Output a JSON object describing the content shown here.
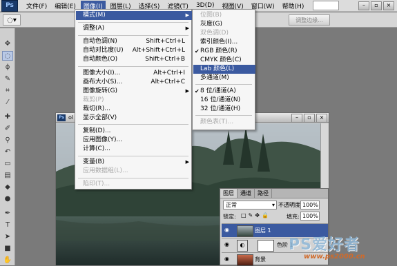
{
  "menubar": {
    "logo": "Ps",
    "items": [
      "文件(F)",
      "编辑(E)",
      "图像(I)",
      "图层(L)",
      "选择(S)",
      "滤镜(T)",
      "3D(D)",
      "视图(V)",
      "窗口(W)",
      "帮助(H)"
    ],
    "active_index": 2
  },
  "options_bar": {
    "adjust_edge_label": "调整边缘..."
  },
  "image_menu": {
    "items": [
      {
        "label": "模式(M)",
        "shortcut": "",
        "submenu": true,
        "highlight": true,
        "disabled": false
      },
      {
        "label": "调整(A)",
        "shortcut": "",
        "submenu": true,
        "highlight": false,
        "disabled": false
      },
      {
        "label": "自动色调(N)",
        "shortcut": "Shift+Ctrl+L",
        "submenu": false,
        "highlight": false,
        "disabled": false
      },
      {
        "label": "自动对比度(U)",
        "shortcut": "Alt+Shift+Ctrl+L",
        "submenu": false,
        "highlight": false,
        "disabled": false
      },
      {
        "label": "自动颜色(O)",
        "shortcut": "Shift+Ctrl+B",
        "submenu": false,
        "highlight": false,
        "disabled": false
      },
      {
        "label": "图像大小(I)...",
        "shortcut": "Alt+Ctrl+I",
        "submenu": false,
        "highlight": false,
        "disabled": false
      },
      {
        "label": "画布大小(S)...",
        "shortcut": "Alt+Ctrl+C",
        "submenu": false,
        "highlight": false,
        "disabled": false
      },
      {
        "label": "图像旋转(G)",
        "shortcut": "",
        "submenu": true,
        "highlight": false,
        "disabled": false
      },
      {
        "label": "裁剪(P)",
        "shortcut": "",
        "submenu": false,
        "highlight": false,
        "disabled": true
      },
      {
        "label": "裁切(R)...",
        "shortcut": "",
        "submenu": false,
        "highlight": false,
        "disabled": false
      },
      {
        "label": "显示全部(V)",
        "shortcut": "",
        "submenu": false,
        "highlight": false,
        "disabled": false
      },
      {
        "label": "复制(D)...",
        "shortcut": "",
        "submenu": false,
        "highlight": false,
        "disabled": false
      },
      {
        "label": "应用图像(Y)...",
        "shortcut": "",
        "submenu": false,
        "highlight": false,
        "disabled": false
      },
      {
        "label": "计算(C)...",
        "shortcut": "",
        "submenu": false,
        "highlight": false,
        "disabled": false
      },
      {
        "label": "变量(B)",
        "shortcut": "",
        "submenu": true,
        "highlight": false,
        "disabled": false
      },
      {
        "label": "应用数据组(L)...",
        "shortcut": "",
        "submenu": false,
        "highlight": false,
        "disabled": true
      },
      {
        "label": "陷印(T)...",
        "shortcut": "",
        "submenu": false,
        "highlight": false,
        "disabled": true
      }
    ]
  },
  "mode_submenu": {
    "items": [
      {
        "label": "位图(B)",
        "checked": false,
        "highlight": false,
        "disabled": true
      },
      {
        "label": "灰度(G)",
        "checked": false,
        "highlight": false,
        "disabled": false
      },
      {
        "label": "双色调(D)",
        "checked": false,
        "highlight": false,
        "disabled": true
      },
      {
        "label": "索引颜色(I)...",
        "checked": false,
        "highlight": false,
        "disabled": false
      },
      {
        "label": "RGB 颜色(R)",
        "checked": true,
        "highlight": false,
        "disabled": false
      },
      {
        "label": "CMYK 颜色(C)",
        "checked": false,
        "highlight": false,
        "disabled": false
      },
      {
        "label": "Lab 颜色(L)",
        "checked": false,
        "highlight": true,
        "disabled": false
      },
      {
        "label": "多通道(M)",
        "checked": false,
        "highlight": false,
        "disabled": false
      },
      {
        "label": "8 位/通道(A)",
        "checked": true,
        "highlight": false,
        "disabled": false
      },
      {
        "label": "16 位/通道(N)",
        "checked": false,
        "highlight": false,
        "disabled": false
      },
      {
        "label": "32 位/通道(H)",
        "checked": false,
        "highlight": false,
        "disabled": false
      },
      {
        "label": "颜色表(T)...",
        "checked": false,
        "highlight": false,
        "disabled": true
      }
    ]
  },
  "document": {
    "title": "ol"
  },
  "layers_panel": {
    "tabs": [
      "图层",
      "通道",
      "路径"
    ],
    "blend_mode": "正常",
    "opacity_label": "不透明度:",
    "opacity": "100%",
    "lock_label": "锁定:",
    "fill_label": "填充:",
    "fill": "100%",
    "layers": [
      {
        "name": "图层 1",
        "selected": true
      },
      {
        "name": "色阶 1",
        "selected": false
      },
      {
        "name": "背景",
        "selected": false
      }
    ]
  },
  "watermark": {
    "logo": "PS爱好者",
    "url": "www.ps2000.cn"
  }
}
